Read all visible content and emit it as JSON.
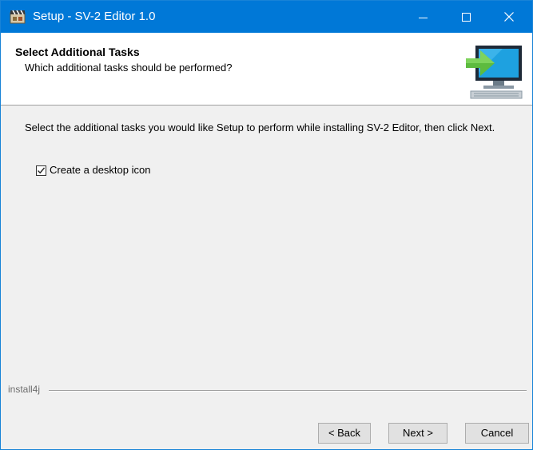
{
  "window": {
    "title": "Setup - SV-2 Editor 1.0",
    "accent_color": "#0078d7",
    "icons": [
      "app-icon",
      "minimize-icon",
      "maximize-icon",
      "close-icon"
    ]
  },
  "header": {
    "title": "Select Additional Tasks",
    "subtitle": "Which additional tasks should be performed?",
    "icon": "install-computer-icon"
  },
  "content": {
    "instructions": "Select the additional tasks you would like Setup to perform while installing SV-2 Editor, then click Next.",
    "tasks": [
      {
        "label": "Create a desktop icon",
        "checked": true
      }
    ]
  },
  "footer": {
    "brand": "install4j",
    "back_label": "< Back",
    "next_label": "Next >",
    "cancel_label": "Cancel"
  }
}
